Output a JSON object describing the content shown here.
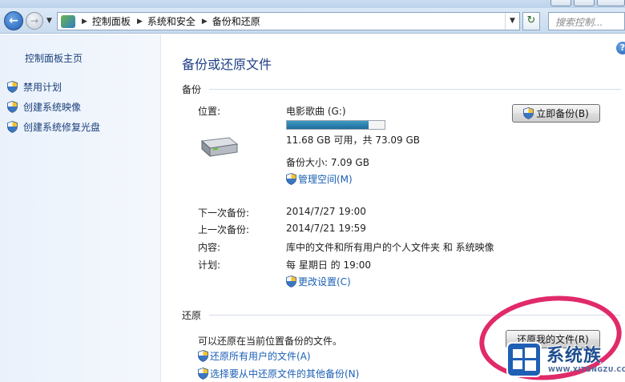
{
  "nav": {
    "breadcrumbs": [
      "控制面板",
      "系统和安全",
      "备份和还原"
    ],
    "search_placeholder": "搜索控制..."
  },
  "left_pane": {
    "home": "控制面板主页",
    "items": [
      {
        "label": "禁用计划",
        "icon": "uac-shield-icon"
      },
      {
        "label": "创建系统映像",
        "icon": "uac-shield-icon"
      },
      {
        "label": "创建系统修复光盘",
        "icon": "uac-shield-icon"
      }
    ]
  },
  "main": {
    "title": "备份或还原文件",
    "backup": {
      "heading": "备份",
      "location_label": "位置:",
      "location_value": "电影歌曲 (G:)",
      "drive_used_fraction": 0.84,
      "space_text": "11.68 GB 可用，共 73.09 GB",
      "backup_size_text": "备份大小: 7.09 GB",
      "manage_space_link": "管理空间(M)",
      "backup_now_button": "立即备份(B)",
      "next_label": "下一次备份:",
      "next_value": "2014/7/27 19:00",
      "last_label": "上一次备份:",
      "last_value": "2014/7/21 19:59",
      "contents_label": "内容:",
      "contents_value": "库中的文件和所有用户的个人文件夹 和 系统映像",
      "schedule_label": "计划:",
      "schedule_value": "每 星期日 的 19:00",
      "change_settings_link": "更改设置(C)"
    },
    "restore": {
      "heading": "还原",
      "description": "可以还原在当前位置备份的文件。",
      "restore_my_files_button": "还原我的文件(R)",
      "restore_all_users_link": "还原所有用户的文件(A)",
      "select_other_backup_link": "选择要从中还原文件的其他备份(N)"
    }
  },
  "watermark": {
    "text": "系统族",
    "subtext": "WWW.XITONGZU.COM"
  },
  "colors": {
    "link": "#1a5fb4",
    "title": "#1e3f85",
    "highlight_ring": "#e02a6a",
    "progress_fill": "#1e6c9a"
  }
}
